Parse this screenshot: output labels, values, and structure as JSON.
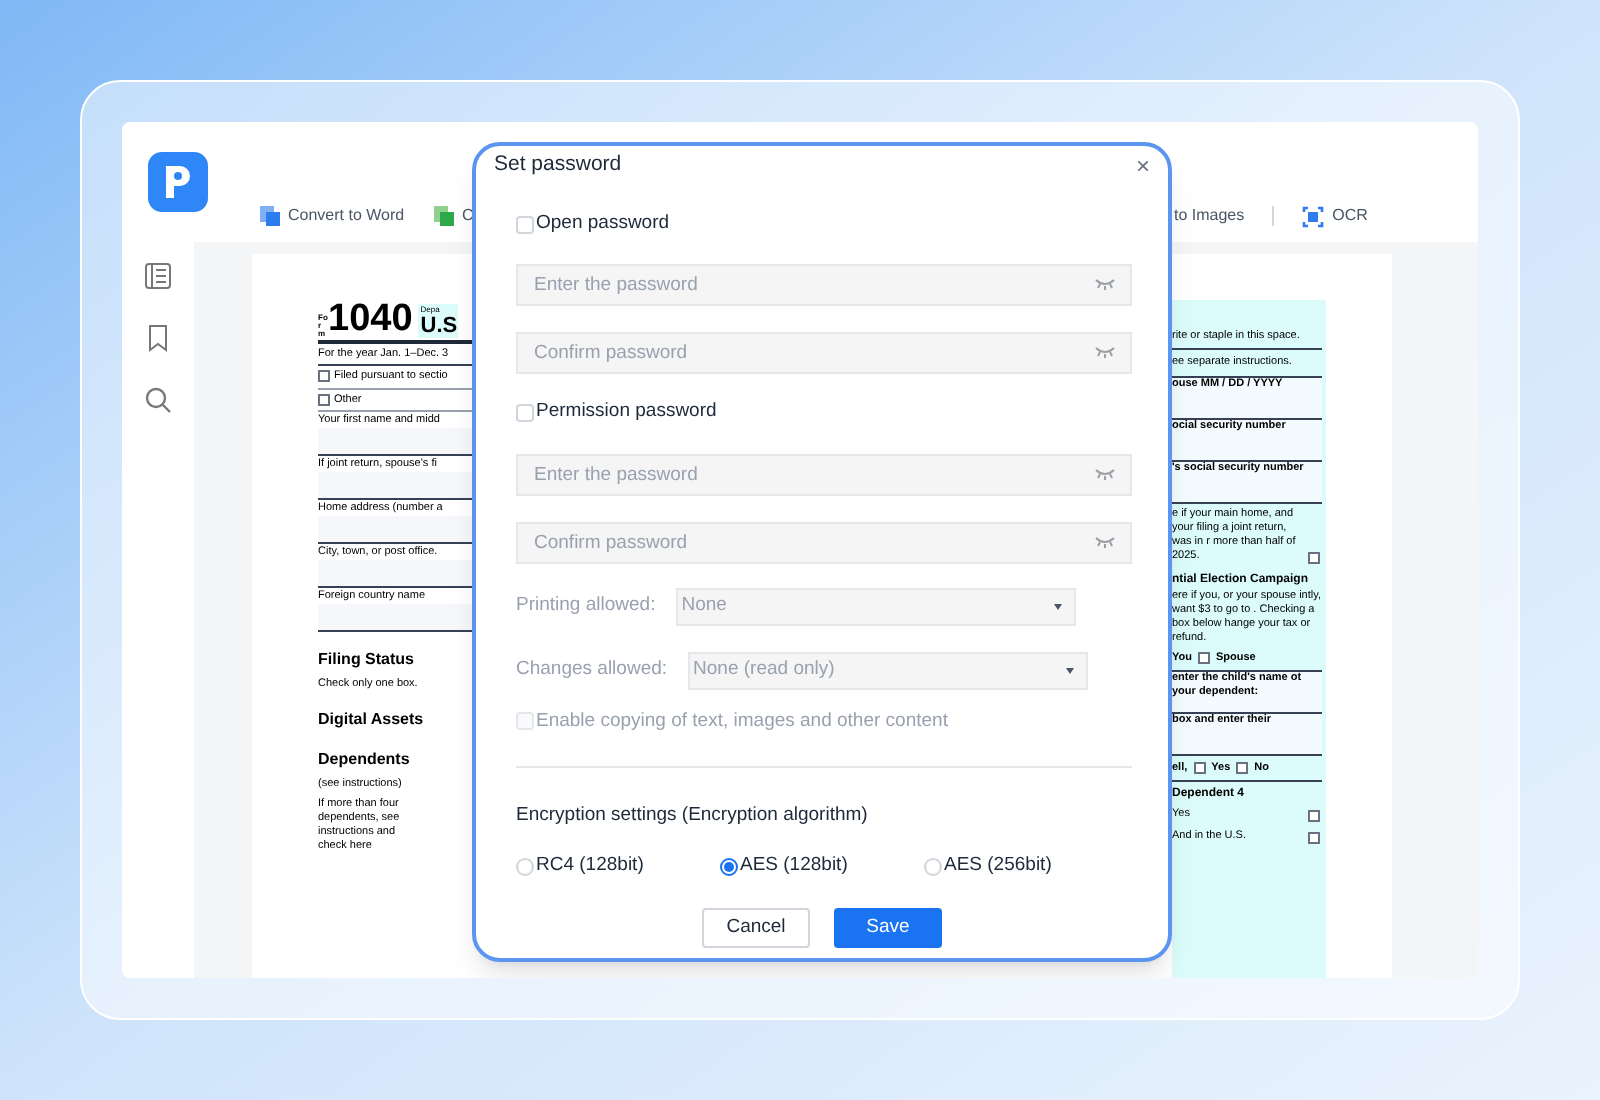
{
  "toolbar": [
    {
      "label": "Convert to Word",
      "kind": "word"
    },
    {
      "label": "C",
      "kind": "sheet"
    },
    {
      "label": "to Images",
      "kind": "none"
    },
    {
      "label": "OCR",
      "kind": "ocr"
    }
  ],
  "document": {
    "form_word": "Form",
    "form_number": "1040",
    "dept": "Depa",
    "title": "U.S",
    "left": [
      {
        "kind": "text",
        "text": "For the year Jan. 1–Dec. 3"
      },
      {
        "kind": "check",
        "text": "Filed pursuant to sectio"
      },
      {
        "kind": "check",
        "text": "Other"
      },
      {
        "kind": "field",
        "text": "Your first name and midd"
      },
      {
        "kind": "field",
        "text": "If joint return, spouse's fi"
      },
      {
        "kind": "field",
        "text": "Home address (number a"
      },
      {
        "kind": "field",
        "text": "City, town, or post office."
      },
      {
        "kind": "field",
        "text": "Foreign country name"
      },
      {
        "kind": "heading",
        "text": "Filing Status"
      },
      {
        "kind": "note",
        "text": "Check only one box."
      },
      {
        "kind": "heading",
        "text": "Digital Assets"
      },
      {
        "kind": "heading",
        "text": "Dependents"
      },
      {
        "kind": "note",
        "text": "(see instructions)"
      },
      {
        "kind": "note",
        "text": "If more than four dependents, see instructions and check here"
      }
    ],
    "right": [
      {
        "kind": "text",
        "text": "rite or staple in this space."
      },
      {
        "kind": "text",
        "text": "ee separate instructions."
      },
      {
        "kind": "field",
        "text": "ouse MM / DD / YYYY"
      },
      {
        "kind": "field",
        "text": "ocial security number"
      },
      {
        "kind": "field",
        "text": "'s social security number"
      },
      {
        "kind": "check",
        "text": "e if your main home, and your filing a joint return, was in r more than half of 2025."
      },
      {
        "kind": "heading",
        "text": "ntial Election Campaign"
      },
      {
        "kind": "note",
        "text": "ere if you, or your spouse intly, want $3 to go to . Checking a box below hange your tax or refund."
      },
      {
        "kind": "pair",
        "text": "You",
        "text2": "Spouse"
      },
      {
        "kind": "field",
        "text": "enter the child's name ot your dependent:"
      },
      {
        "kind": "field",
        "text": "box and enter their"
      },
      {
        "kind": "pair",
        "text": "ell,",
        "text2": "Yes",
        "text3": "No"
      },
      {
        "kind": "heading",
        "text": "Dependent 4"
      },
      {
        "kind": "check",
        "text": "Yes"
      },
      {
        "kind": "check",
        "text": "And in the U.S."
      }
    ]
  },
  "dialog": {
    "title": "Set password",
    "close": "×",
    "groups": [
      {
        "label": "Open password",
        "checked": false,
        "fields": [
          {
            "placeholder": "Enter the password",
            "disabled": true
          },
          {
            "placeholder": "Confirm password",
            "disabled": true
          }
        ]
      },
      {
        "label": "Permission password",
        "checked": false,
        "fields": [
          {
            "placeholder": "Enter the password",
            "disabled": true
          },
          {
            "placeholder": "Confirm password",
            "disabled": true
          }
        ]
      }
    ],
    "permissions": [
      {
        "label": "Printing allowed:",
        "value": "None",
        "disabled": true
      },
      {
        "label": "Changes allowed:",
        "value": "None (read only)",
        "disabled": true
      }
    ],
    "copy_option": {
      "label": "Enable copying of text, images and other content",
      "checked": false,
      "disabled": true
    },
    "encryption": {
      "heading": "Encryption settings (Encryption algorithm)",
      "options": [
        {
          "label": "RC4 (128bit)",
          "selected": false
        },
        {
          "label": "AES (128bit)",
          "selected": true
        },
        {
          "label": "AES (256bit)",
          "selected": false
        }
      ]
    },
    "buttons": [
      {
        "label": "Cancel",
        "kind": "secondary"
      },
      {
        "label": "Save",
        "kind": "primary"
      }
    ]
  }
}
